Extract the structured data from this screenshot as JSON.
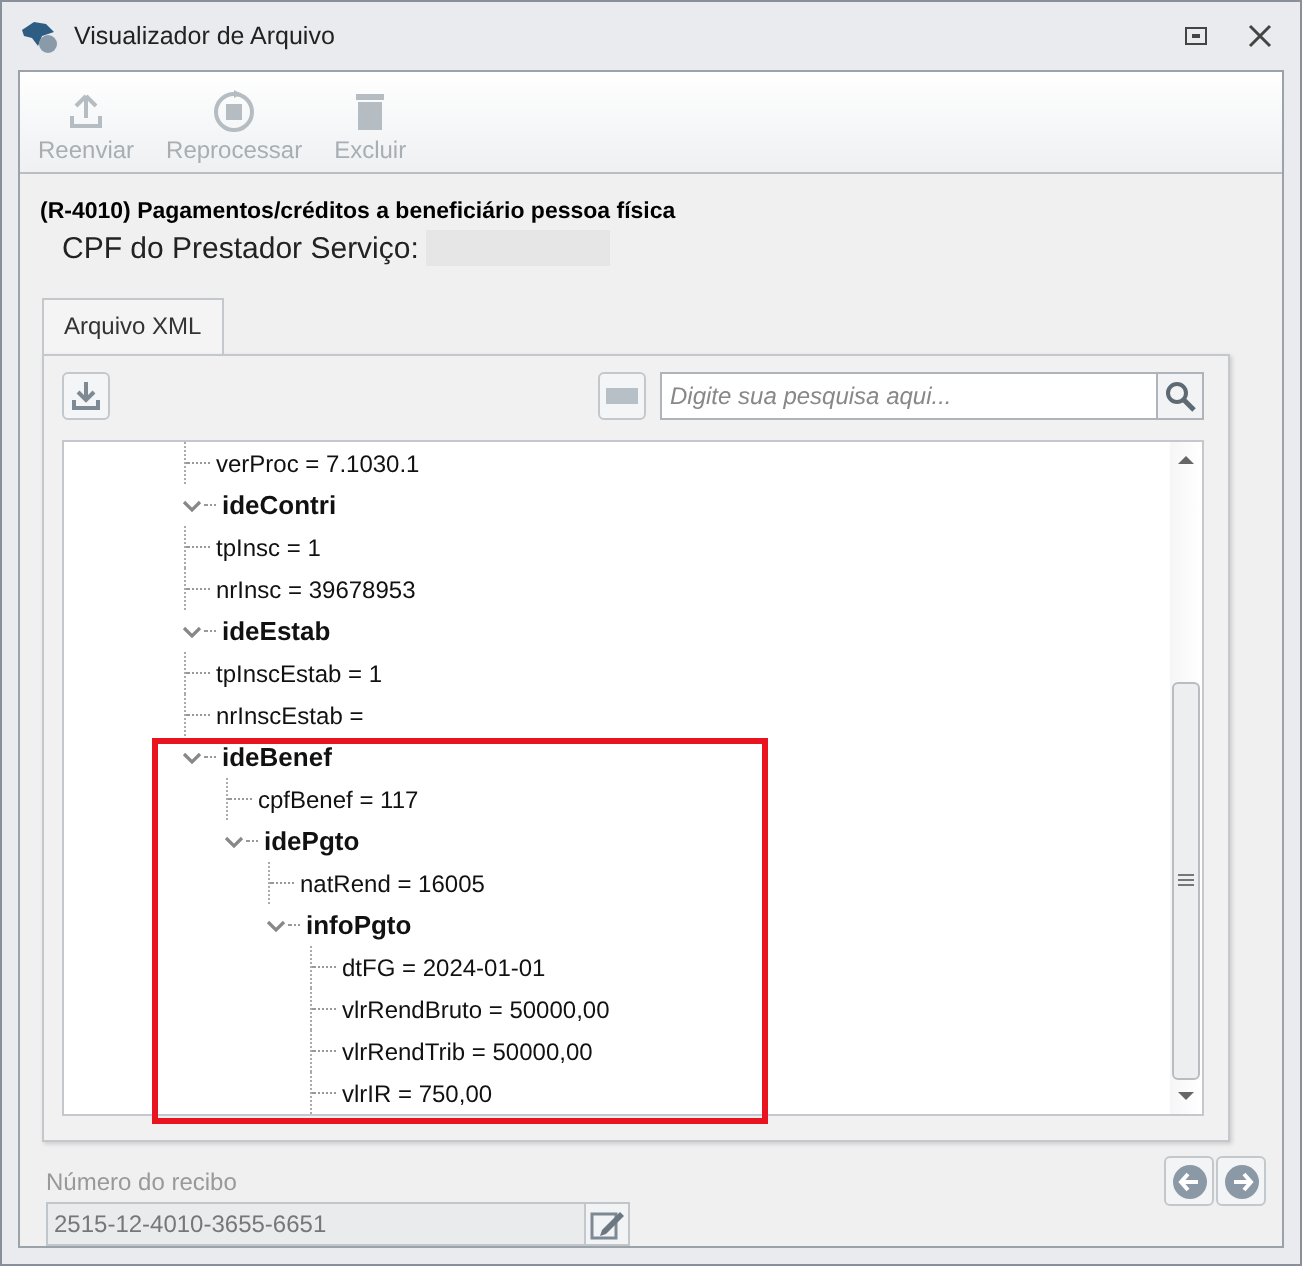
{
  "window": {
    "title": "Visualizador de Arquivo"
  },
  "toolbar": [
    {
      "label": "Reenviar",
      "kind": "upload",
      "disabled": true
    },
    {
      "label": "Reprocessar",
      "kind": "reprocess",
      "disabled": true
    },
    {
      "label": "Excluir",
      "kind": "delete",
      "disabled": true
    }
  ],
  "heading": "(R-4010) Pagamentos/créditos a beneficiário pessoa física",
  "cpf_label": "CPF do Prestador Serviço:",
  "tabs": [
    {
      "label": "Arquivo XML",
      "selected": true
    }
  ],
  "search": {
    "placeholder": "Digite sua pesquisa aqui..."
  },
  "tree": [
    {
      "children": [
        {
          "label": "verProc = 7.1030.1"
        }
      ]
    },
    {
      "label": "ideContri",
      "expanded": true,
      "children": [
        {
          "label": "tpInsc = 1"
        },
        {
          "label": "nrInsc = 39678953"
        }
      ]
    },
    {
      "label": "ideEstab",
      "expanded": true,
      "children": [
        {
          "label": "tpInscEstab = 1"
        },
        {
          "label": "nrInscEstab ="
        },
        {
          "label": "ideBenef",
          "expanded": true,
          "children": [
            {
              "label": "cpfBenef = 117"
            },
            {
              "label": "idePgto",
              "expanded": true,
              "children": [
                {
                  "label": "natRend = 16005"
                },
                {
                  "label": "infoPgto",
                  "expanded": true,
                  "children": [
                    {
                      "label": "dtFG = 2024-01-01"
                    },
                    {
                      "label": "vlrRendBruto = 50000,00"
                    },
                    {
                      "label": "vlrRendTrib = 50000,00"
                    },
                    {
                      "label": "vlrIR = 750,00"
                    }
                  ]
                }
              ]
            }
          ]
        }
      ]
    }
  ],
  "receipt": {
    "label": "Número do recibo",
    "value": "2515-12-4010-3655-6651",
    "disabled": true
  }
}
